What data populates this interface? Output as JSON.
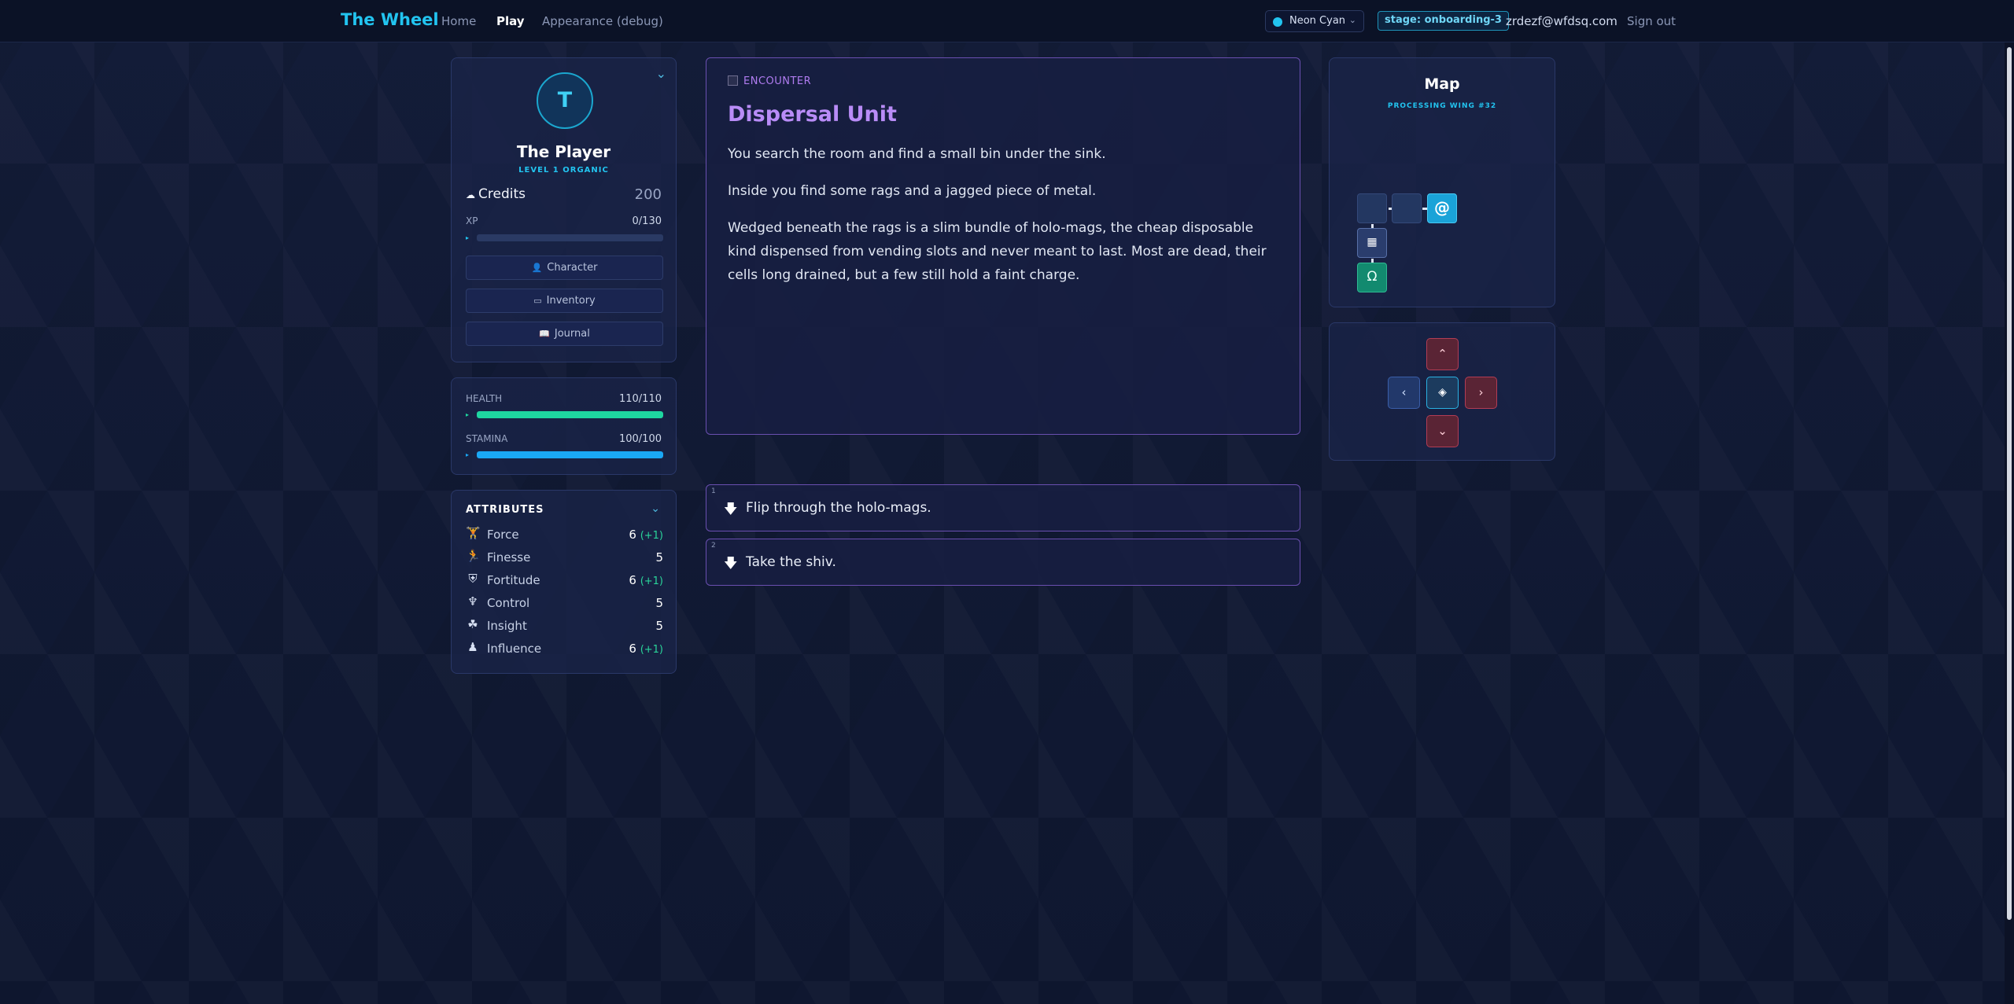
{
  "nav": {
    "brand": "The Wheel",
    "links": [
      "Home",
      "Play",
      "Appearance (debug)"
    ],
    "theme": "Neon Cyan",
    "stage": "stage: onboarding-3",
    "email": "zrdezf@wfdsq.com",
    "signout": "Sign out"
  },
  "colors": {
    "accent": "#22c4f0",
    "purple": "#b98cf7",
    "health": "#1ed6a0",
    "stamina": "#1aa8f5"
  },
  "character": {
    "avatar_initial": "T",
    "name": "The Player",
    "level": "LEVEL 1 ORGANIC",
    "credits_label": "Credits",
    "credits_value": "200",
    "xp_label": "XP",
    "xp_value": "0/130",
    "xp_fraction": 0,
    "buttons": [
      "Character",
      "Inventory",
      "Journal"
    ]
  },
  "vitals": {
    "health_label": "HEALTH",
    "health_value": "110/110",
    "health_fraction": 1,
    "stamina_label": "STAMINA",
    "stamina_value": "100/100",
    "stamina_fraction": 1
  },
  "attributes": {
    "title": "ATTRIBUTES",
    "items": [
      {
        "name": "Force",
        "value": "6",
        "bonus": "(+1)",
        "icon": "dumbbell-icon"
      },
      {
        "name": "Finesse",
        "value": "5",
        "bonus": "",
        "icon": "dash-icon"
      },
      {
        "name": "Fortitude",
        "value": "6",
        "bonus": "(+1)",
        "icon": "shield-icon"
      },
      {
        "name": "Control",
        "value": "5",
        "bonus": "",
        "icon": "chalice-icon"
      },
      {
        "name": "Insight",
        "value": "5",
        "bonus": "",
        "icon": "bug-icon"
      },
      {
        "name": "Influence",
        "value": "6",
        "bonus": "(+1)",
        "icon": "crown-icon"
      }
    ]
  },
  "encounter": {
    "tag": "ENCOUNTER",
    "title": "Dispersal Unit",
    "paragraphs": [
      "You search the room and find a small bin under the sink.",
      "Inside you find some rags and a jagged piece of metal.",
      "Wedged beneath the rags is a slim bundle of holo-mags, the cheap disposable kind dispensed from vending slots and never meant to last. Most are dead, their cells long drained, but a few still hold a faint charge."
    ]
  },
  "choices": [
    {
      "num": "1",
      "text": "Flip through the holo-mags."
    },
    {
      "num": "2",
      "text": "Take the shiv."
    }
  ],
  "map": {
    "title": "Map",
    "subtitle": "PROCESSING WING #32",
    "current_symbol": "@"
  }
}
